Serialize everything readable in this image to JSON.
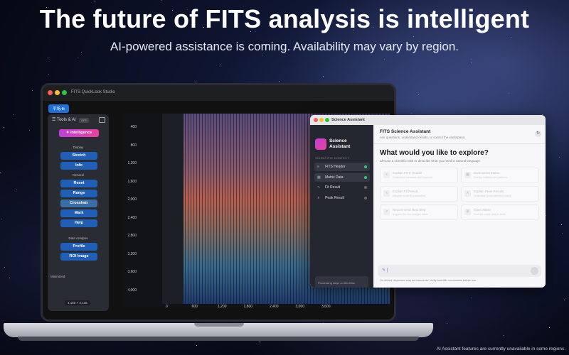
{
  "hero": {
    "title": "The future of FITS analysis is intelligent",
    "subtitle": "AI-powered assistance is coming. Availability may vary by region."
  },
  "main_window": {
    "app_title": "FITS QuickLook Studio",
    "file_tab": "平场.fit",
    "tools_panel": {
      "title": "Tools & AI",
      "badge": "OFF",
      "intelligence_button": "Intelligence",
      "display_label": "Display",
      "display_buttons": [
        "Stretch",
        "Info"
      ],
      "general_label": "General",
      "general_buttons": [
        "Reset",
        "Range",
        "Crosshair",
        "Mark",
        "Help"
      ],
      "analysis_label": "Data Analysis",
      "analysis_buttons": [
        "Profile",
        "ROI Image"
      ],
      "minimized_label": "Minimized",
      "image_size": "4,160 × 4,136"
    },
    "plot": {
      "y_ticks": [
        "400",
        "800",
        "1,200",
        "1,600",
        "2,000",
        "2,400",
        "2,800",
        "3,200",
        "3,600",
        "4,000"
      ],
      "x_ticks": [
        "0",
        "600",
        "1,200",
        "1,800",
        "2,400",
        "3,000",
        "3,600"
      ]
    }
  },
  "assistant_window": {
    "window_title": "Science Assistant",
    "brand": "Science Assistant",
    "section_label": "SCIENTIFIC CONTEXT",
    "context_items": [
      {
        "label": "FITS Header",
        "icon": "≡",
        "status": "#2ecc71",
        "active": true
      },
      {
        "label": "Matrix Data",
        "icon": "▦",
        "status": "#2ecc71",
        "active": true
      },
      {
        "label": "Fit Result",
        "icon": "∿",
        "status": "#666",
        "active": false
      },
      {
        "label": "Peak Result",
        "icon": "∧",
        "status": "#666",
        "active": false
      }
    ],
    "footer_note": "Processing stays on this Mac.",
    "header_title": "FITS Science Assistant",
    "header_subtitle": "Ask questions, understand results, or control the workspace.",
    "question": "What would you like to explore?",
    "question_subtitle": "Choose a scientific task or describe what you need in natural language.",
    "suggestions": [
      {
        "title": "Explain FITS Header",
        "subtitle": "Understand metadata and keywords"
      },
      {
        "title": "Summarize Matrix",
        "subtitle": "Get key statistics and patterns"
      },
      {
        "title": "Explain Fit Result",
        "subtitle": "Interpret model fit parameters"
      },
      {
        "title": "Explain Peak Results",
        "subtitle": "Understand peak detection output"
      },
      {
        "title": "Recommend Next Step",
        "subtitle": "Suggest the next analysis action"
      },
      {
        "title": "Open Matrix",
        "subtitle": "View the matrix data in detail"
      }
    ],
    "input_icon": "✎ |",
    "disclaimer": "On-device responses may be inaccurate. Verify scientific conclusions before use."
  },
  "bottom_note": "AI Assistant  features are currently unavailable in some regions.",
  "colors": {
    "accent_blue": "#1f5fb8",
    "intelligence_gradient_start": "#c13fd8",
    "intelligence_gradient_end": "#ec3f9d"
  },
  "icons": {
    "refresh": "refresh-icon",
    "send": "send-icon"
  }
}
